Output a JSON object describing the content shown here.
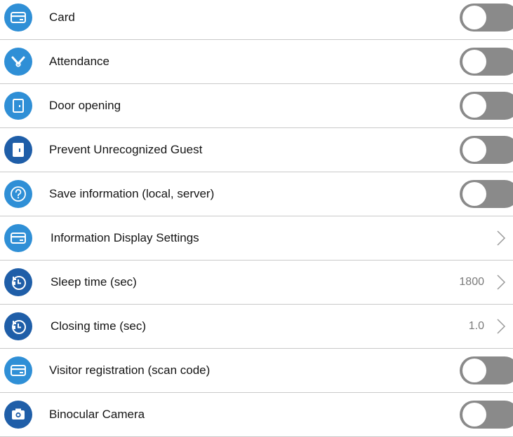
{
  "settings": [
    {
      "label": "Card",
      "control": "toggle",
      "checked": false,
      "icon": "card-icon"
    },
    {
      "label": "Attendance",
      "control": "toggle",
      "checked": false,
      "icon": "attendance-icon"
    },
    {
      "label": "Door opening",
      "control": "toggle",
      "checked": false,
      "icon": "door-icon"
    },
    {
      "label": "Prevent Unrecognized Guest",
      "control": "toggle",
      "checked": false,
      "icon": "door-lock-icon"
    },
    {
      "label": "Save information (local, server)",
      "control": "toggle",
      "checked": false,
      "icon": "question-icon"
    },
    {
      "label": "Information Display Settings",
      "control": "chevron",
      "icon": "card-icon"
    },
    {
      "label": "Sleep time (sec)",
      "control": "chevron",
      "value": "1800",
      "icon": "timer-icon"
    },
    {
      "label": "Closing time (sec)",
      "control": "chevron",
      "value": "1.0",
      "icon": "timer-icon"
    },
    {
      "label": "Visitor registration (scan code)",
      "control": "toggle",
      "checked": false,
      "icon": "card-icon"
    },
    {
      "label": "Binocular Camera",
      "control": "toggle",
      "checked": false,
      "icon": "camera-icon"
    }
  ],
  "colors": {
    "icon_light": "#2f8fd6",
    "icon_dark": "#1f5ea8",
    "toggle_off": "#8a8a8a",
    "divider": "#c9c9c9",
    "value_text": "#7a7a7a"
  }
}
